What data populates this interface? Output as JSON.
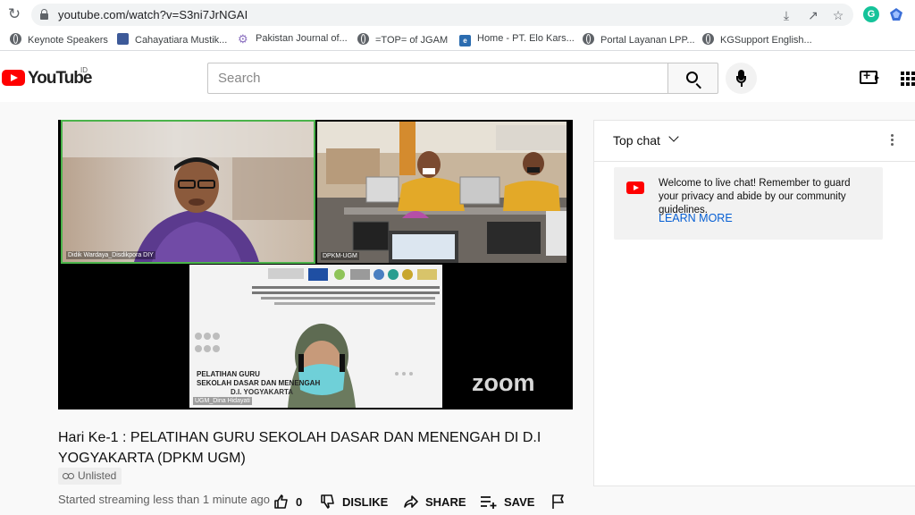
{
  "browser": {
    "url": "youtube.com/watch?v=S3ni7JrNGAI",
    "bookmarks": [
      {
        "label": "Keynote Speakers",
        "icon": "globe-icon"
      },
      {
        "label": "Cahayatiara Mustik...",
        "icon": "site-square-icon"
      },
      {
        "label": "Pakistan Journal of...",
        "icon": "gear-icon"
      },
      {
        "label": "=TOP= of JGAM",
        "icon": "globe-icon"
      },
      {
        "label": "Home - PT. Elo Kars...",
        "icon": "ep-icon"
      },
      {
        "label": "Portal Layanan LPP...",
        "icon": "globe-icon"
      },
      {
        "label": "KGSupport English...",
        "icon": "globe-icon"
      }
    ],
    "extension_g": "G"
  },
  "header": {
    "logo_text": "YouTube",
    "country_code": "ID",
    "search_placeholder": "Search"
  },
  "player": {
    "participants": [
      "Didik Wardaya_Disdikpora DIY",
      "DPKM-UGM",
      "UGM_Dina Hidayati"
    ],
    "watermark": "zoom",
    "slide": {
      "program": "PELATIHAN GURU",
      "subtitle": "SEKOLAH DASAR DAN MENENGAH",
      "region": "D.I. YOGYAKARTA"
    }
  },
  "video": {
    "title": "Hari Ke-1 : PELATIHAN GURU SEKOLAH DASAR DAN MENENGAH DI D.I YOGYAKARTA (DPKM UGM)",
    "badge": "Unlisted",
    "status": "Started streaming less than 1 minute ago",
    "actions": {
      "like_count": "0",
      "dislike": "DISLIKE",
      "share": "SHARE",
      "save": "SAVE"
    }
  },
  "chat": {
    "title": "Top chat",
    "welcome": "Welcome to live chat! Remember to guard your privacy and abide by our community guidelines.",
    "learn_more": "LEARN MORE"
  },
  "colors": {
    "brand_red": "#ff0000",
    "link_blue": "#065fd4",
    "active_speaker_border": "#4bb34b"
  }
}
